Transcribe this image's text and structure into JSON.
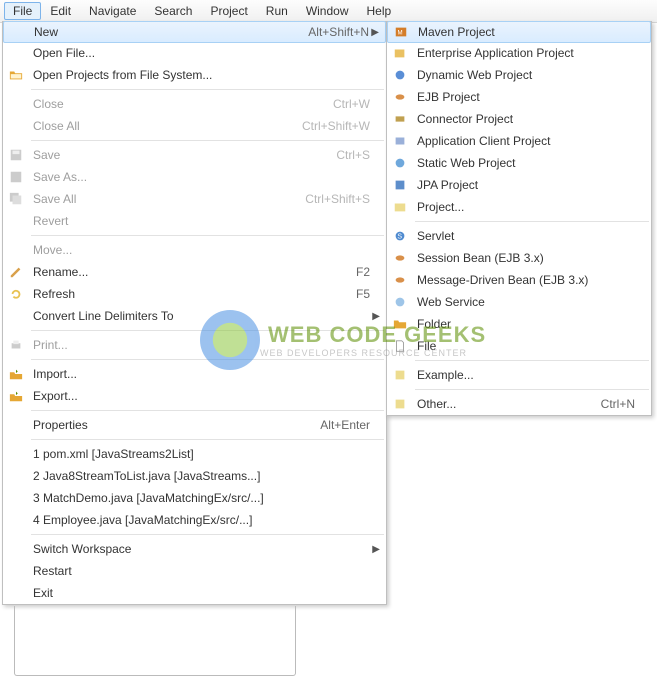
{
  "menubar": [
    "File",
    "Edit",
    "Navigate",
    "Search",
    "Project",
    "Run",
    "Window",
    "Help"
  ],
  "fileMenu": {
    "new": {
      "label": "New",
      "shortcut": "Alt+Shift+N",
      "arrow": true,
      "highlighted": true
    },
    "openFile": {
      "label": "Open File..."
    },
    "openProjFS": {
      "label": "Open Projects from File System..."
    },
    "close": {
      "label": "Close",
      "shortcut": "Ctrl+W",
      "disabled": true
    },
    "closeAll": {
      "label": "Close All",
      "shortcut": "Ctrl+Shift+W",
      "disabled": true
    },
    "save": {
      "label": "Save",
      "shortcut": "Ctrl+S",
      "disabled": true
    },
    "saveAs": {
      "label": "Save As...",
      "disabled": true
    },
    "saveAll": {
      "label": "Save All",
      "shortcut": "Ctrl+Shift+S",
      "disabled": true
    },
    "revert": {
      "label": "Revert",
      "disabled": true
    },
    "move": {
      "label": "Move...",
      "disabled": true
    },
    "rename": {
      "label": "Rename...",
      "shortcut": "F2"
    },
    "refresh": {
      "label": "Refresh",
      "shortcut": "F5"
    },
    "convert": {
      "label": "Convert Line Delimiters To",
      "arrow": true
    },
    "print": {
      "label": "Print...",
      "disabled": true
    },
    "import": {
      "label": "Import..."
    },
    "export": {
      "label": "Export..."
    },
    "properties": {
      "label": "Properties",
      "shortcut": "Alt+Enter"
    },
    "recent1": {
      "label": "1 pom.xml  [JavaStreams2List]"
    },
    "recent2": {
      "label": "2 Java8StreamToList.java  [JavaStreams...]"
    },
    "recent3": {
      "label": "3 MatchDemo.java  [JavaMatchingEx/src/...]"
    },
    "recent4": {
      "label": "4 Employee.java  [JavaMatchingEx/src/...]"
    },
    "switchWs": {
      "label": "Switch Workspace",
      "arrow": true
    },
    "restart": {
      "label": "Restart"
    },
    "exit": {
      "label": "Exit"
    }
  },
  "newMenu": {
    "maven": {
      "label": "Maven Project",
      "highlighted": true
    },
    "ent": {
      "label": "Enterprise Application Project"
    },
    "dynWeb": {
      "label": "Dynamic Web Project"
    },
    "ejb": {
      "label": "EJB Project"
    },
    "conn": {
      "label": "Connector Project"
    },
    "appCli": {
      "label": "Application Client Project"
    },
    "stWeb": {
      "label": "Static Web Project"
    },
    "jpa": {
      "label": "JPA Project"
    },
    "project": {
      "label": "Project..."
    },
    "servlet": {
      "label": "Servlet"
    },
    "session": {
      "label": "Session Bean (EJB 3.x)"
    },
    "mdb": {
      "label": "Message-Driven Bean (EJB 3.x)"
    },
    "webSvc": {
      "label": "Web Service"
    },
    "folder": {
      "label": "Folder"
    },
    "file": {
      "label": "File"
    },
    "example": {
      "label": "Example..."
    },
    "other": {
      "label": "Other...",
      "shortcut": "Ctrl+N"
    }
  },
  "watermark": {
    "title": "WEB CODE GEEKS",
    "subtitle": "WEB DEVELOPERS RESOURCE CENTER"
  }
}
